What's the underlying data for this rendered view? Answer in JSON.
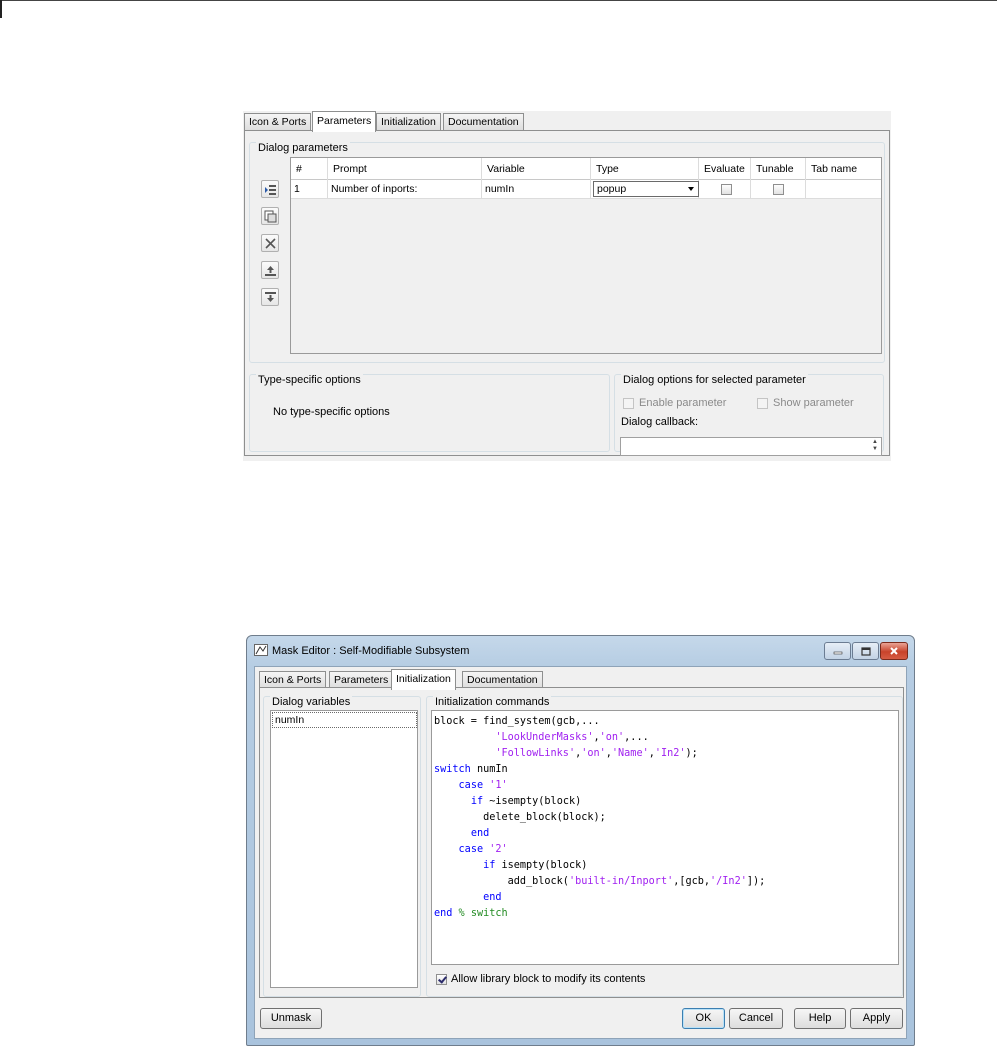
{
  "panel1": {
    "tabs": [
      "Icon & Ports",
      "Parameters",
      "Initialization",
      "Documentation"
    ],
    "active_tab": "Parameters",
    "dialog_parameters_title": "Dialog parameters",
    "table": {
      "columns": [
        "#",
        "Prompt",
        "Variable",
        "Type",
        "Evaluate",
        "Tunable",
        "Tab name"
      ],
      "rows": [
        {
          "num": "1",
          "prompt": "Number of inports:",
          "variable": "numIn",
          "type": "popup",
          "evaluate": false,
          "tunable": false,
          "tab_name": ""
        }
      ]
    },
    "toolbar_icons": [
      "add-parameter-icon",
      "copy-parameter-icon",
      "delete-parameter-icon",
      "move-up-icon",
      "move-down-icon"
    ],
    "type_specific_title": "Type-specific options",
    "type_specific_text": "No type-specific options",
    "dialog_options_title": "Dialog options for selected parameter",
    "enable_parameter_label": "Enable parameter",
    "show_parameter_label": "Show parameter",
    "dialog_callback_label": "Dialog callback:",
    "dialog_callback_value": ""
  },
  "panel2": {
    "window_title": "Mask Editor : Self-Modifiable Subsystem",
    "tabs": [
      "Icon & Ports",
      "Parameters",
      "Initialization",
      "Documentation"
    ],
    "active_tab": "Initialization",
    "dialog_variables_title": "Dialog variables",
    "dialog_variables": [
      "numIn"
    ],
    "init_commands_title": "Initialization commands",
    "code_lines": [
      "block = find_system(gcb,...",
      "          'LookUnderMasks','on',...",
      "          'FollowLinks','on','Name','In2');",
      "switch numIn",
      "    case '1'",
      "      if ~isempty(block)",
      "        delete_block(block);",
      "      end",
      "    case '2'",
      "        if isempty(block)",
      "            add_block('built-in/Inport',[gcb,'/In2']);",
      "        end",
      "end % switch"
    ],
    "allow_modify_label": "Allow library block to modify its contents",
    "allow_modify_checked": true,
    "buttons": {
      "unmask": "Unmask",
      "ok": "OK",
      "cancel": "Cancel",
      "help": "Help",
      "apply": "Apply"
    }
  },
  "colors": {
    "keyword": "#0000ff",
    "string": "#a020f0",
    "comment": "#228b22",
    "window_frame": "#b6cde3"
  }
}
